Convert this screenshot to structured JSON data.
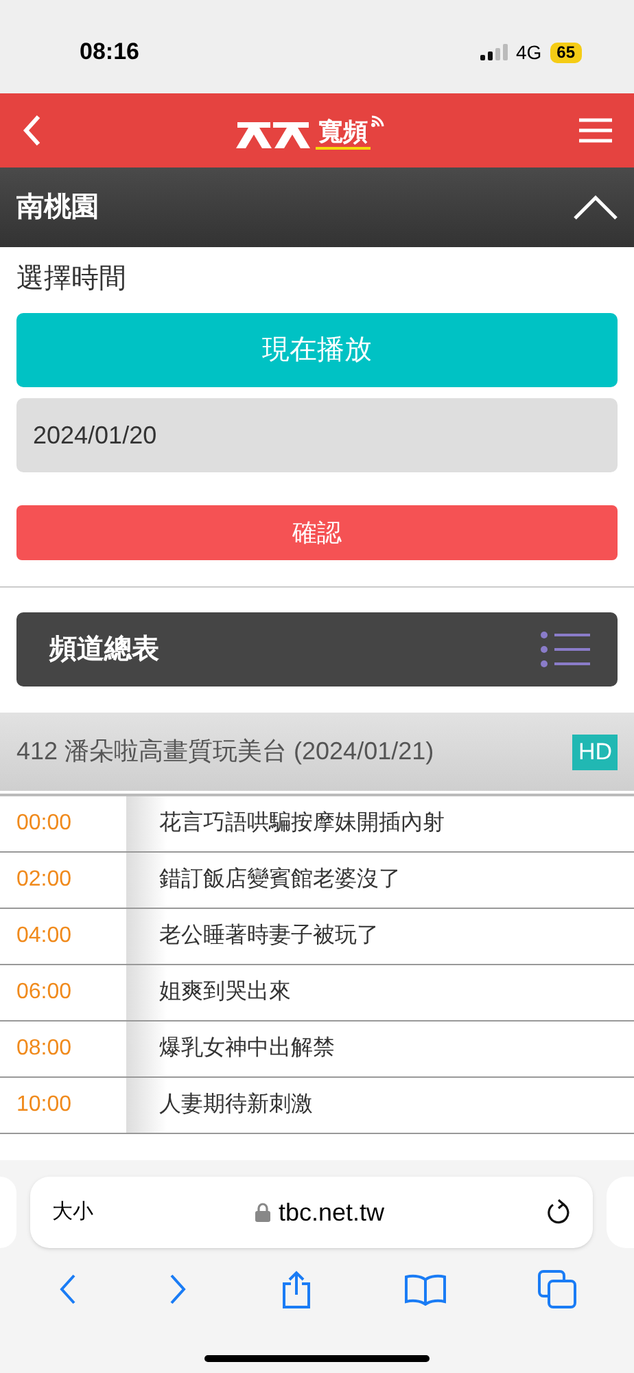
{
  "status_bar": {
    "time": "08:16",
    "network": "4G",
    "battery": "65"
  },
  "header": {
    "logo_text": "寬頻"
  },
  "region": {
    "title": "南桃園",
    "expanded": true
  },
  "time_picker": {
    "label": "選擇時間",
    "now_button": "現在播放",
    "date": "2024/01/20",
    "confirm_button": "確認"
  },
  "channel_list_button": "頻道總表",
  "channel": {
    "title": "412 潘朵啦高畫質玩美台 (2024/01/21)",
    "badge": "HD"
  },
  "schedule": [
    {
      "time": "00:00",
      "title": "花言巧語哄騙按摩妹開插內射"
    },
    {
      "time": "02:00",
      "title": "錯訂飯店變賓館老婆沒了"
    },
    {
      "time": "04:00",
      "title": "老公睡著時妻子被玩了"
    },
    {
      "time": "06:00",
      "title": "姐爽到哭出來"
    },
    {
      "time": "08:00",
      "title": "爆乳女神中出解禁"
    },
    {
      "time": "10:00",
      "title": "人妻期待新刺激"
    }
  ],
  "browser": {
    "text_size": "大小",
    "url": "tbc.net.tw"
  }
}
